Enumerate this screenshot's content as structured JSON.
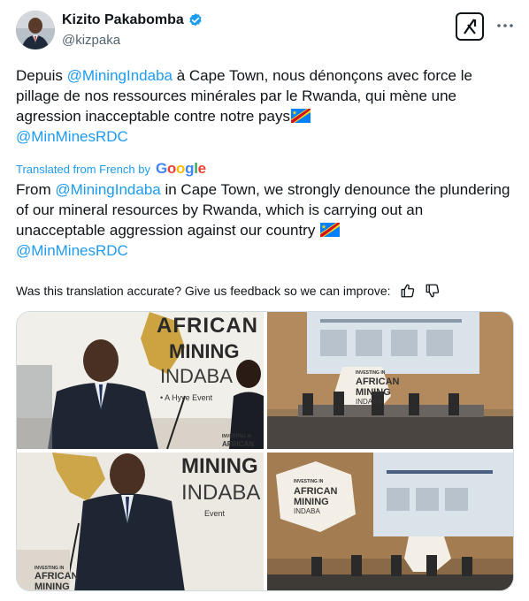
{
  "author": {
    "name": "Kizito Pakabomba",
    "handle": "@kizpaka"
  },
  "post": {
    "original_before": "Depuis ",
    "original_mention_1": "@MiningIndaba",
    "original_after": " à Cape Town, nous dénonçons avec force le pillage de nos ressources minérales par le Rwanda, qui mène une agression inacceptable contre notre pays",
    "original_mention_2": "@MinMinesRDC",
    "translated_label": "Translated from French by",
    "google_letters": [
      "G",
      "o",
      "o",
      "g",
      "l",
      "e"
    ],
    "translation_before": "From ",
    "translation_mention_1": "@MiningIndaba",
    "translation_after": " in Cape Town, we strongly denounce the plundering of our mineral resources by Rwanda, which is carrying out an unacceptable aggression against our country ",
    "translation_mention_2": "@MinMinesRDC",
    "feedback_question": "Was this translation accurate? Give us feedback so we can improve:"
  },
  "photos": {
    "p1_line1": "AFRICAN",
    "p1_line2": "MINING",
    "p1_line3": "INDABA",
    "p1_line4": "• A Hyve Event",
    "p1_badge1": "INVESTING IN",
    "p1_badge2": "AFRICAN",
    "p2_line1": "INVESTING IN",
    "p2_line2": "AFRICAN",
    "p2_line3": "MINING",
    "p2_line4": "INDABA",
    "p3_line1": "MINING",
    "p3_line2": "INDABA",
    "p3_line3": "Event",
    "p3_badge1": "INVESTING IN",
    "p3_badge2": "AFRICAN",
    "p3_badge3": "MINING",
    "p4_line1": "INVESTING IN",
    "p4_line2": "AFRICAN",
    "p4_line3": "MINING",
    "p4_line4": "INDABA"
  },
  "colors": {
    "link": "#1d9bf0",
    "muted": "#536471",
    "verified": "#1d9bf0",
    "google": [
      "#4285f4",
      "#ea4335",
      "#fbbc05",
      "#4285f4",
      "#34a853",
      "#ea4335"
    ]
  },
  "icons": [
    "verified-badge-icon",
    "grok-icon",
    "more-icon",
    "drc-flag-icon",
    "thumbs-up-icon",
    "thumbs-down-icon"
  ]
}
